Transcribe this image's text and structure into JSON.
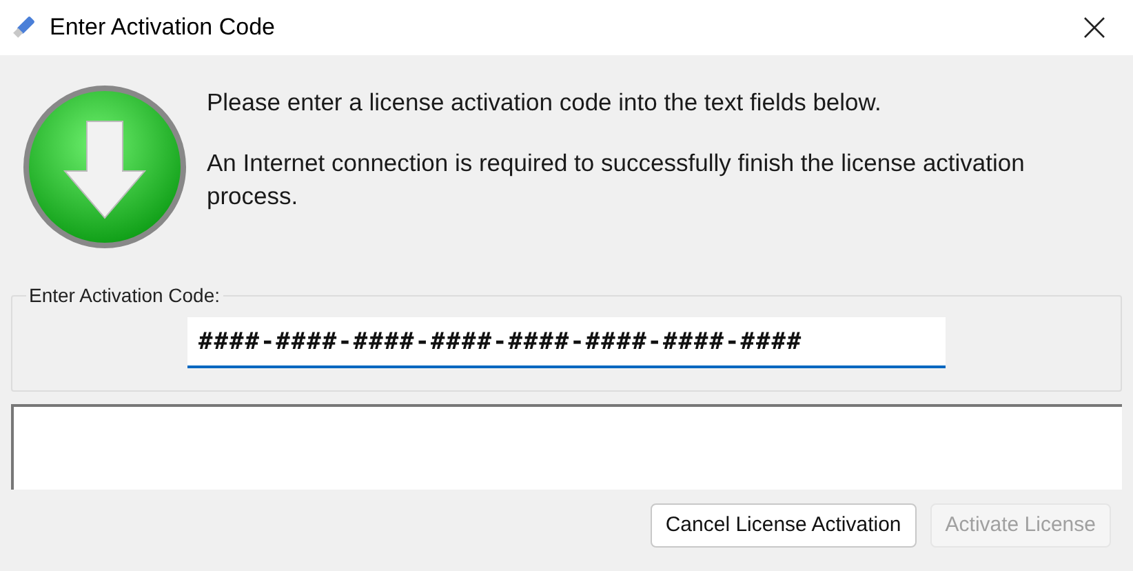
{
  "window": {
    "title": "Enter Activation Code"
  },
  "message": {
    "line_1": "Please enter a license activation code into the text fields below.",
    "line_2": "An Internet connection is required to successfully finish the license activation process."
  },
  "code_group": {
    "label": "Enter Activation Code:",
    "field": {
      "value": "####-####-####-####-####-####-####-####"
    }
  },
  "buttons": [
    {
      "label": "Cancel License Activation",
      "disabled": false
    },
    {
      "label": "Activate License",
      "disabled": true
    }
  ]
}
